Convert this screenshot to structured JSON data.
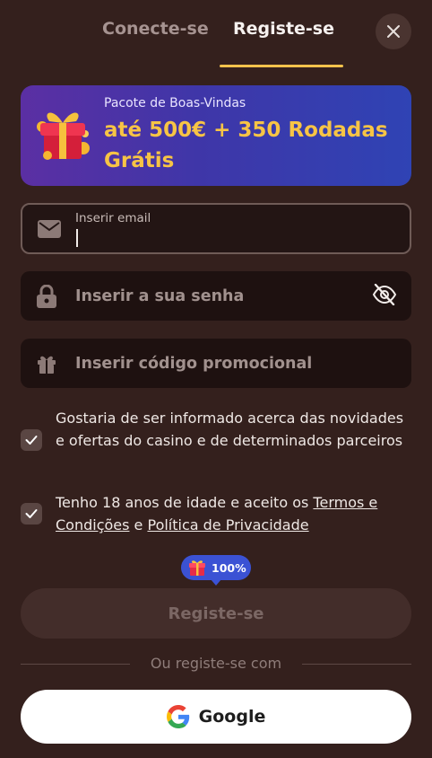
{
  "tabs": {
    "login": "Conecte-se",
    "register": "Registe-se"
  },
  "banner": {
    "subtitle": "Pacote de Boas-Vindas",
    "title": "até 500€ + 350 Rodadas Grátis"
  },
  "form": {
    "email_label": "Inserir email",
    "email_value": "",
    "password_placeholder": "Inserir a sua senha",
    "promo_placeholder": "Inserir código promocional"
  },
  "consents": {
    "marketing": {
      "checked": true,
      "text": "Gostaria de ser informado acerca das novidades e ofertas do casino e de determinados parceiros"
    },
    "terms": {
      "checked": true,
      "text_before": "Tenho 18 anos de idade e aceito os ",
      "terms_link": "Termos e Condições",
      "text_between": " e ",
      "privacy_link": "Política de Privacidade"
    }
  },
  "bonus_badge": {
    "percent": "100%"
  },
  "submit_button": "Registe-se",
  "divider_text": "Ou registe-se com",
  "google_button": "Google",
  "colors": {
    "background": "#34201d",
    "accent": "#f3c24c",
    "banner_start": "#5b2fa3",
    "banner_end": "#2f43b4",
    "badge": "#3b52d4"
  },
  "icons": {
    "close": "close-icon",
    "email": "envelope-icon",
    "password": "lock-icon",
    "visibility": "eye-off-icon",
    "promo": "gift-icon",
    "check": "check-icon",
    "google": "google-logo-icon"
  }
}
